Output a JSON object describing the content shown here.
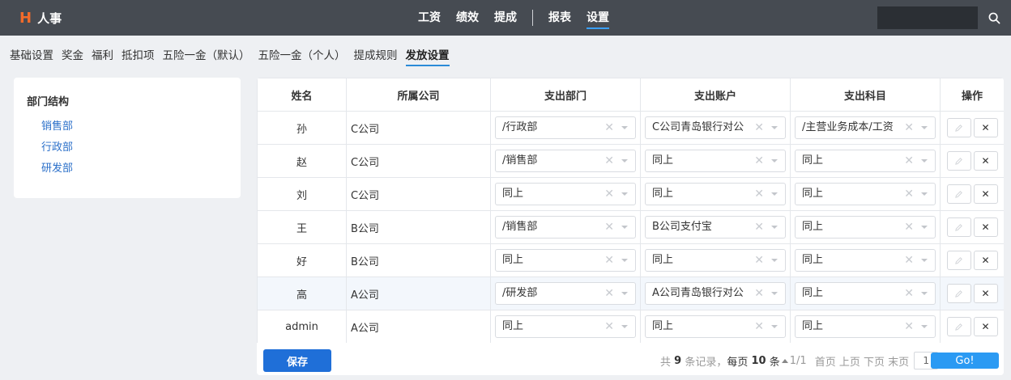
{
  "brand": {
    "mark": "H",
    "name": "人事"
  },
  "topnav": {
    "group1": [
      "工资",
      "绩效",
      "提成"
    ],
    "group2": [
      "报表",
      "设置"
    ],
    "active": "设置"
  },
  "search": {
    "placeholder": "",
    "icon": "search-icon"
  },
  "subtabs": [
    "基础设置",
    "奖金",
    "福利",
    "抵扣项",
    "五险一金（默认）",
    "五险一金（个人）",
    "提成规则",
    "发放设置"
  ],
  "subtab_active": "发放设置",
  "dept": {
    "title": "部门结构",
    "items": [
      "销售部",
      "行政部",
      "研发部"
    ]
  },
  "table": {
    "headers": [
      "姓名",
      "所属公司",
      "支出部门",
      "支出账户",
      "支出科目",
      "操作"
    ],
    "rows": [
      {
        "name": "孙",
        "company": "C公司",
        "dept": "/行政部",
        "account": "C公司青岛银行对公",
        "subject": "/主营业务成本/工资"
      },
      {
        "name": "赵",
        "company": "C公司",
        "dept": "/销售部",
        "account": "同上",
        "subject": "同上"
      },
      {
        "name": "刘",
        "company": "C公司",
        "dept": "同上",
        "account": "同上",
        "subject": "同上"
      },
      {
        "name": "王",
        "company": "B公司",
        "dept": "/销售部",
        "account": "B公司支付宝",
        "subject": "同上"
      },
      {
        "name": "好",
        "company": "B公司",
        "dept": "同上",
        "account": "同上",
        "subject": "同上"
      },
      {
        "name": "高",
        "company": "A公司",
        "dept": "/研发部",
        "account": "A公司青岛银行对公",
        "subject": "同上"
      },
      {
        "name": "admin",
        "company": "A公司",
        "dept": "同上",
        "account": "同上",
        "subject": "同上"
      }
    ],
    "edit_icon": "pencil-icon",
    "delete_icon": "close-icon"
  },
  "footer": {
    "save_label": "保存",
    "total_prefix": "共",
    "total_count": "9",
    "total_suffix": "条记录，",
    "per_page_prefix": "每页",
    "per_page_count": "10",
    "per_page_suffix": "条",
    "page_info": "1/1",
    "first": "首页",
    "prev": "上页",
    "next": "下页",
    "last": "末页",
    "page_input": "1",
    "go_label": "Go!"
  },
  "colors": {
    "topbar": "#464b52",
    "brand_accent": "#f26b2a",
    "link": "#2a6fc9",
    "primary_button": "#1f6fd8",
    "go_button": "#2b9af3"
  }
}
